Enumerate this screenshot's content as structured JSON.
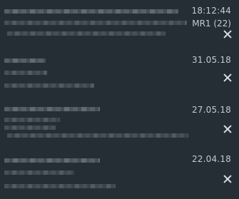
{
  "notifications": [
    {
      "time": "18:12:44",
      "tag": "MR1 (22)"
    },
    {
      "time": "31.05.18"
    },
    {
      "time": "27.05.18"
    },
    {
      "time": "22.04.18"
    }
  ]
}
